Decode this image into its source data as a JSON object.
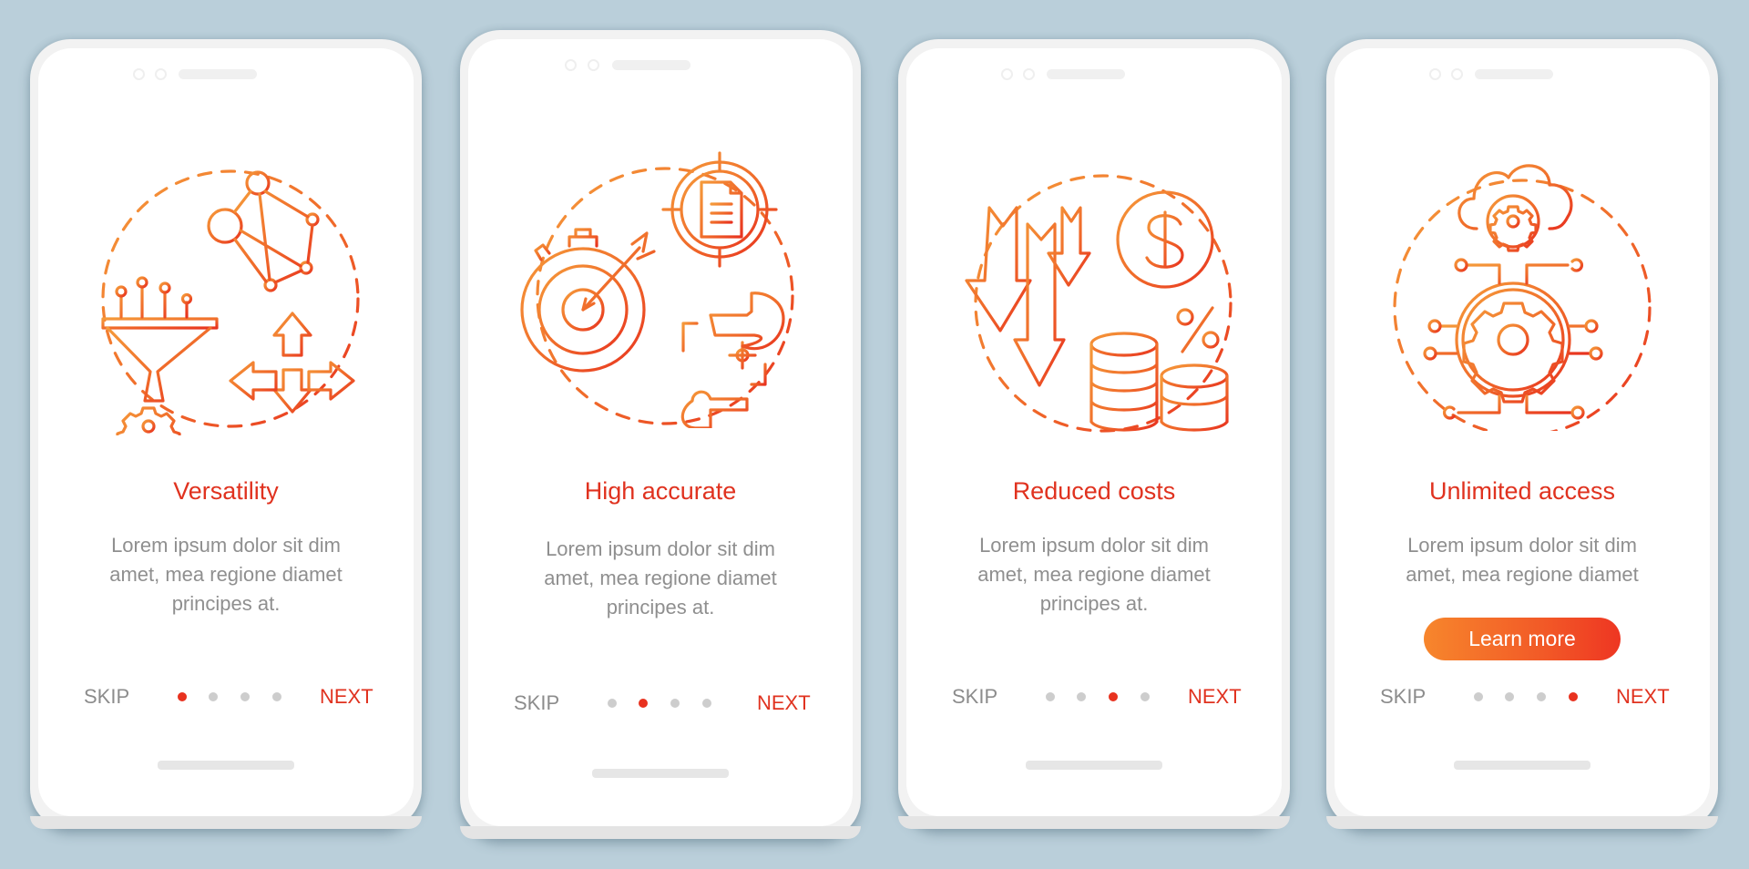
{
  "colors": {
    "background": "#bacfda",
    "accent_red": "#e0321f",
    "accent_orange": "#f7862c",
    "body_text": "#8f8f8f",
    "dot_inactive": "#cdcdcd"
  },
  "screens": [
    {
      "illustration": "versatility-illustration (funnel, network, gear, four-way arrows)",
      "title": "Versatility",
      "body": [
        "Lorem ipsum dolor sit dim",
        "amet, mea regione diamet",
        "principes at."
      ],
      "skip_label": "SKIP",
      "next_label": "NEXT",
      "page_index": 1,
      "page_count": 4
    },
    {
      "illustration": "accuracy-illustration (stopwatch target with arrow, document crosshair, framing hands)",
      "title": "High accurate",
      "body": [
        "Lorem ipsum dolor sit dim",
        "amet, mea regione diamet",
        "principes at."
      ],
      "skip_label": "SKIP",
      "next_label": "NEXT",
      "page_index": 2,
      "page_count": 4
    },
    {
      "illustration": "costs-illustration (down arrows, dollar coin, coin stacks, percent)",
      "title": "Reduced costs",
      "body": [
        "Lorem ipsum dolor sit dim",
        "amet, mea regione diamet",
        "principes at."
      ],
      "skip_label": "SKIP",
      "next_label": "NEXT",
      "page_index": 3,
      "page_count": 4
    },
    {
      "illustration": "access-illustration (cloud gear, circuit gear)",
      "title": "Unlimited access",
      "body": [
        "Lorem ipsum dolor sit dim",
        "amet, mea regione diamet"
      ],
      "button_label": "Learn more",
      "skip_label": "SKIP",
      "next_label": "NEXT",
      "page_index": 4,
      "page_count": 4
    }
  ]
}
